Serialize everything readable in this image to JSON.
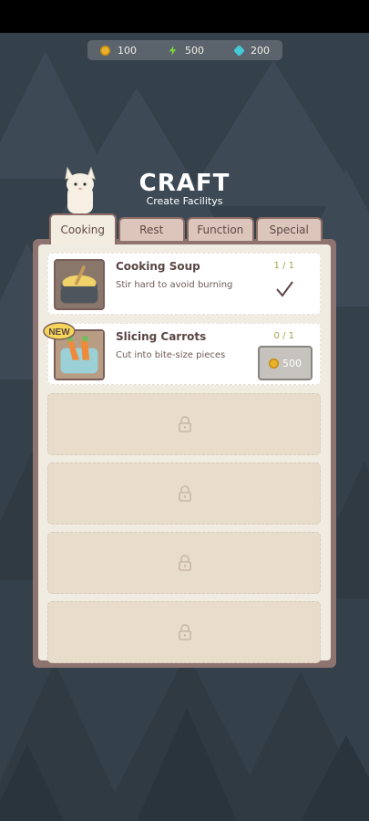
{
  "currency": {
    "coins": "100",
    "energy": "500",
    "gems": "200"
  },
  "header": {
    "title": "CRAFT",
    "subtitle": "Create Facilitys"
  },
  "tabs": [
    {
      "label": "Cooking",
      "active": true
    },
    {
      "label": "Rest",
      "active": false
    },
    {
      "label": "Function",
      "active": false
    },
    {
      "label": "Special",
      "active": false
    }
  ],
  "recipes": [
    {
      "name": "Cooking Soup",
      "description": "Stir hard to avoid burning",
      "count": "1 / 1",
      "status": "completed",
      "icon": "soup-pot-icon"
    },
    {
      "name": "Slicing Carrots",
      "description": "Cut into bite-size pieces",
      "count": "0 / 1",
      "badge": "NEW",
      "price": "500",
      "icon": "carrot-bowl-icon"
    }
  ],
  "locked_slots": 4,
  "colors": {
    "background": "#34404a",
    "panel_frame": "#8e7470",
    "panel_inner": "#f1ece2",
    "tab": "#dcc6bb",
    "tab_active": "#f3ede1",
    "count_text": "#a6a14c",
    "coin": "#e9b22c",
    "energy": "#7bd33a",
    "gem": "#44c9d9"
  }
}
